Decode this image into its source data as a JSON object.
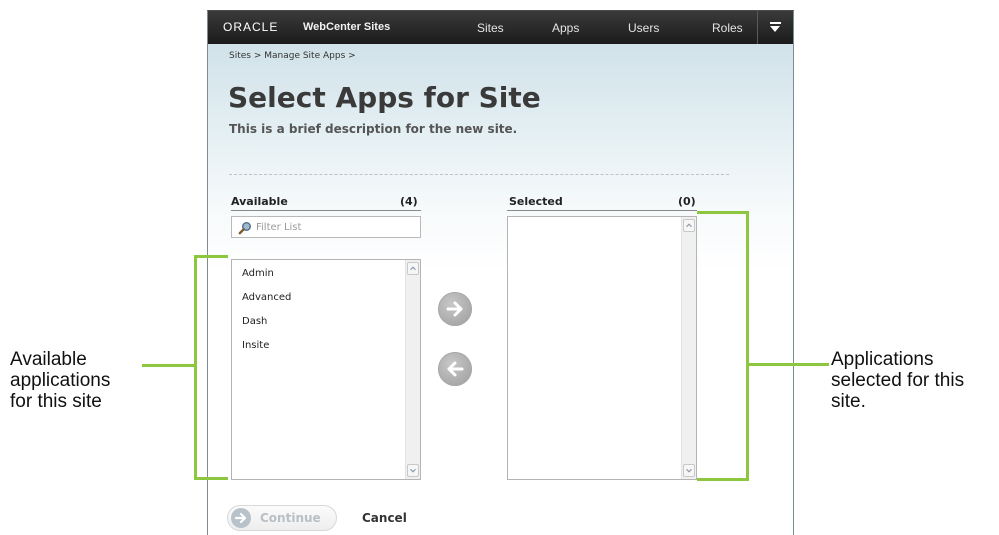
{
  "topbar": {
    "logo": "ORACLE",
    "product": "WebCenter Sites",
    "nav": [
      "Sites",
      "Apps",
      "Users",
      "Roles"
    ],
    "menu_icon": "menu-dropdown-icon"
  },
  "breadcrumb": "Sites > Manage Site Apps >",
  "page": {
    "title": "Select Apps for Site",
    "description": "This is a brief description for the new site."
  },
  "available": {
    "label": "Available",
    "count": "(4)",
    "filter_placeholder": "Filter List",
    "items": [
      "Admin",
      "Advanced",
      "Dash",
      "Insite"
    ]
  },
  "selected": {
    "label": "Selected",
    "count": "(0)",
    "items": []
  },
  "actions": {
    "continue_label": "Continue",
    "cancel_label": "Cancel"
  },
  "annotations": {
    "left": [
      "Available",
      "applications",
      "for this site"
    ],
    "right": [
      "Applications",
      "selected for this",
      "site."
    ]
  },
  "colors": {
    "annotation_green": "#8dc63f",
    "topbar": "#1f1f1f"
  }
}
